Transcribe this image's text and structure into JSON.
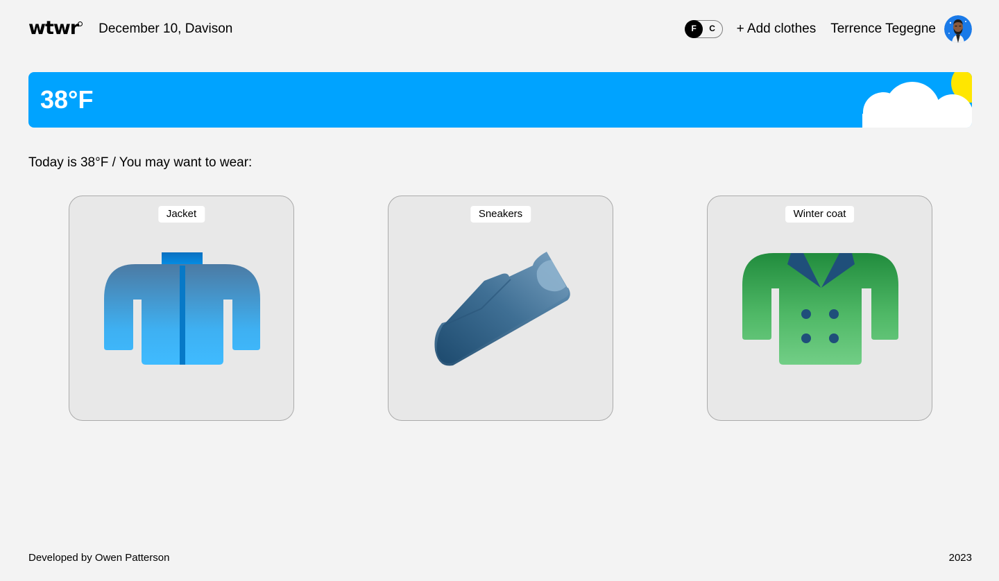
{
  "header": {
    "logo": "wtwr",
    "date_location": "December 10, Davison",
    "unit_toggle": {
      "f_label": "F",
      "c_label": "C",
      "selected": "F"
    },
    "add_clothes_label": "+ Add clothes",
    "user_name": "Terrence Tegegne"
  },
  "weather": {
    "temperature": "38°F",
    "condition_icons": [
      "sun-icon",
      "cloud-icon"
    ],
    "banner_color": "#00a3ff"
  },
  "recommendation": {
    "text": "Today is 38°F / You may want to wear:"
  },
  "items": [
    {
      "label": "Jacket",
      "icon": "jacket-icon"
    },
    {
      "label": "Sneakers",
      "icon": "sneaker-icon"
    },
    {
      "label": "Winter coat",
      "icon": "winter-coat-icon"
    }
  ],
  "footer": {
    "developer": "Developed by Owen Patterson",
    "year": "2023"
  }
}
